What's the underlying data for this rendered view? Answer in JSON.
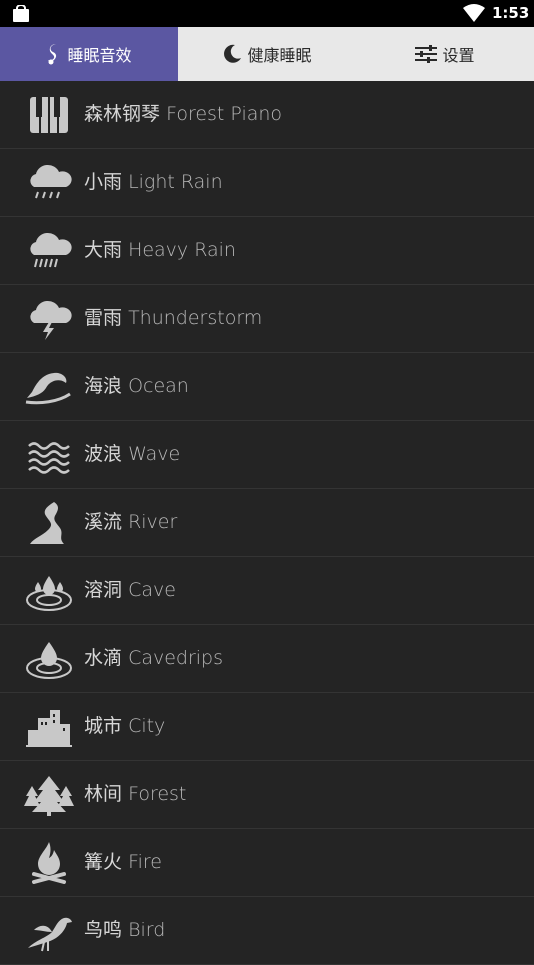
{
  "status_bar": {
    "time": "1:53"
  },
  "tabs": [
    {
      "label": "睡眠音效",
      "icon": "music-note-icon",
      "active": true
    },
    {
      "label": "健康睡眠",
      "icon": "moon-icon",
      "active": false
    },
    {
      "label": "设置",
      "icon": "sliders-icon",
      "active": false
    }
  ],
  "sounds": [
    {
      "zh": "森林钢琴",
      "en": "Forest Piano",
      "icon": "piano-icon"
    },
    {
      "zh": "小雨",
      "en": "Light Rain",
      "icon": "light-rain-icon"
    },
    {
      "zh": "大雨",
      "en": "Heavy Rain",
      "icon": "heavy-rain-icon"
    },
    {
      "zh": "雷雨",
      "en": "Thunderstorm",
      "icon": "thunderstorm-icon"
    },
    {
      "zh": "海浪",
      "en": "Ocean",
      "icon": "ocean-wave-icon"
    },
    {
      "zh": "波浪",
      "en": "Wave",
      "icon": "wave-icon"
    },
    {
      "zh": "溪流",
      "en": "River",
      "icon": "river-icon"
    },
    {
      "zh": "溶洞",
      "en": "Cave",
      "icon": "cave-icon"
    },
    {
      "zh": "水滴",
      "en": "Cavedrips",
      "icon": "water-drop-icon"
    },
    {
      "zh": "城市",
      "en": "City",
      "icon": "city-icon"
    },
    {
      "zh": "林间",
      "en": "Forest",
      "icon": "forest-icon"
    },
    {
      "zh": "篝火",
      "en": "Fire",
      "icon": "fire-icon"
    },
    {
      "zh": "鸟鸣",
      "en": "Bird",
      "icon": "bird-icon"
    }
  ],
  "colors": {
    "tab_active": "#5b57a2",
    "tab_bar": "#e8e8e8",
    "background": "#242424",
    "icon": "#c8c8c8"
  }
}
